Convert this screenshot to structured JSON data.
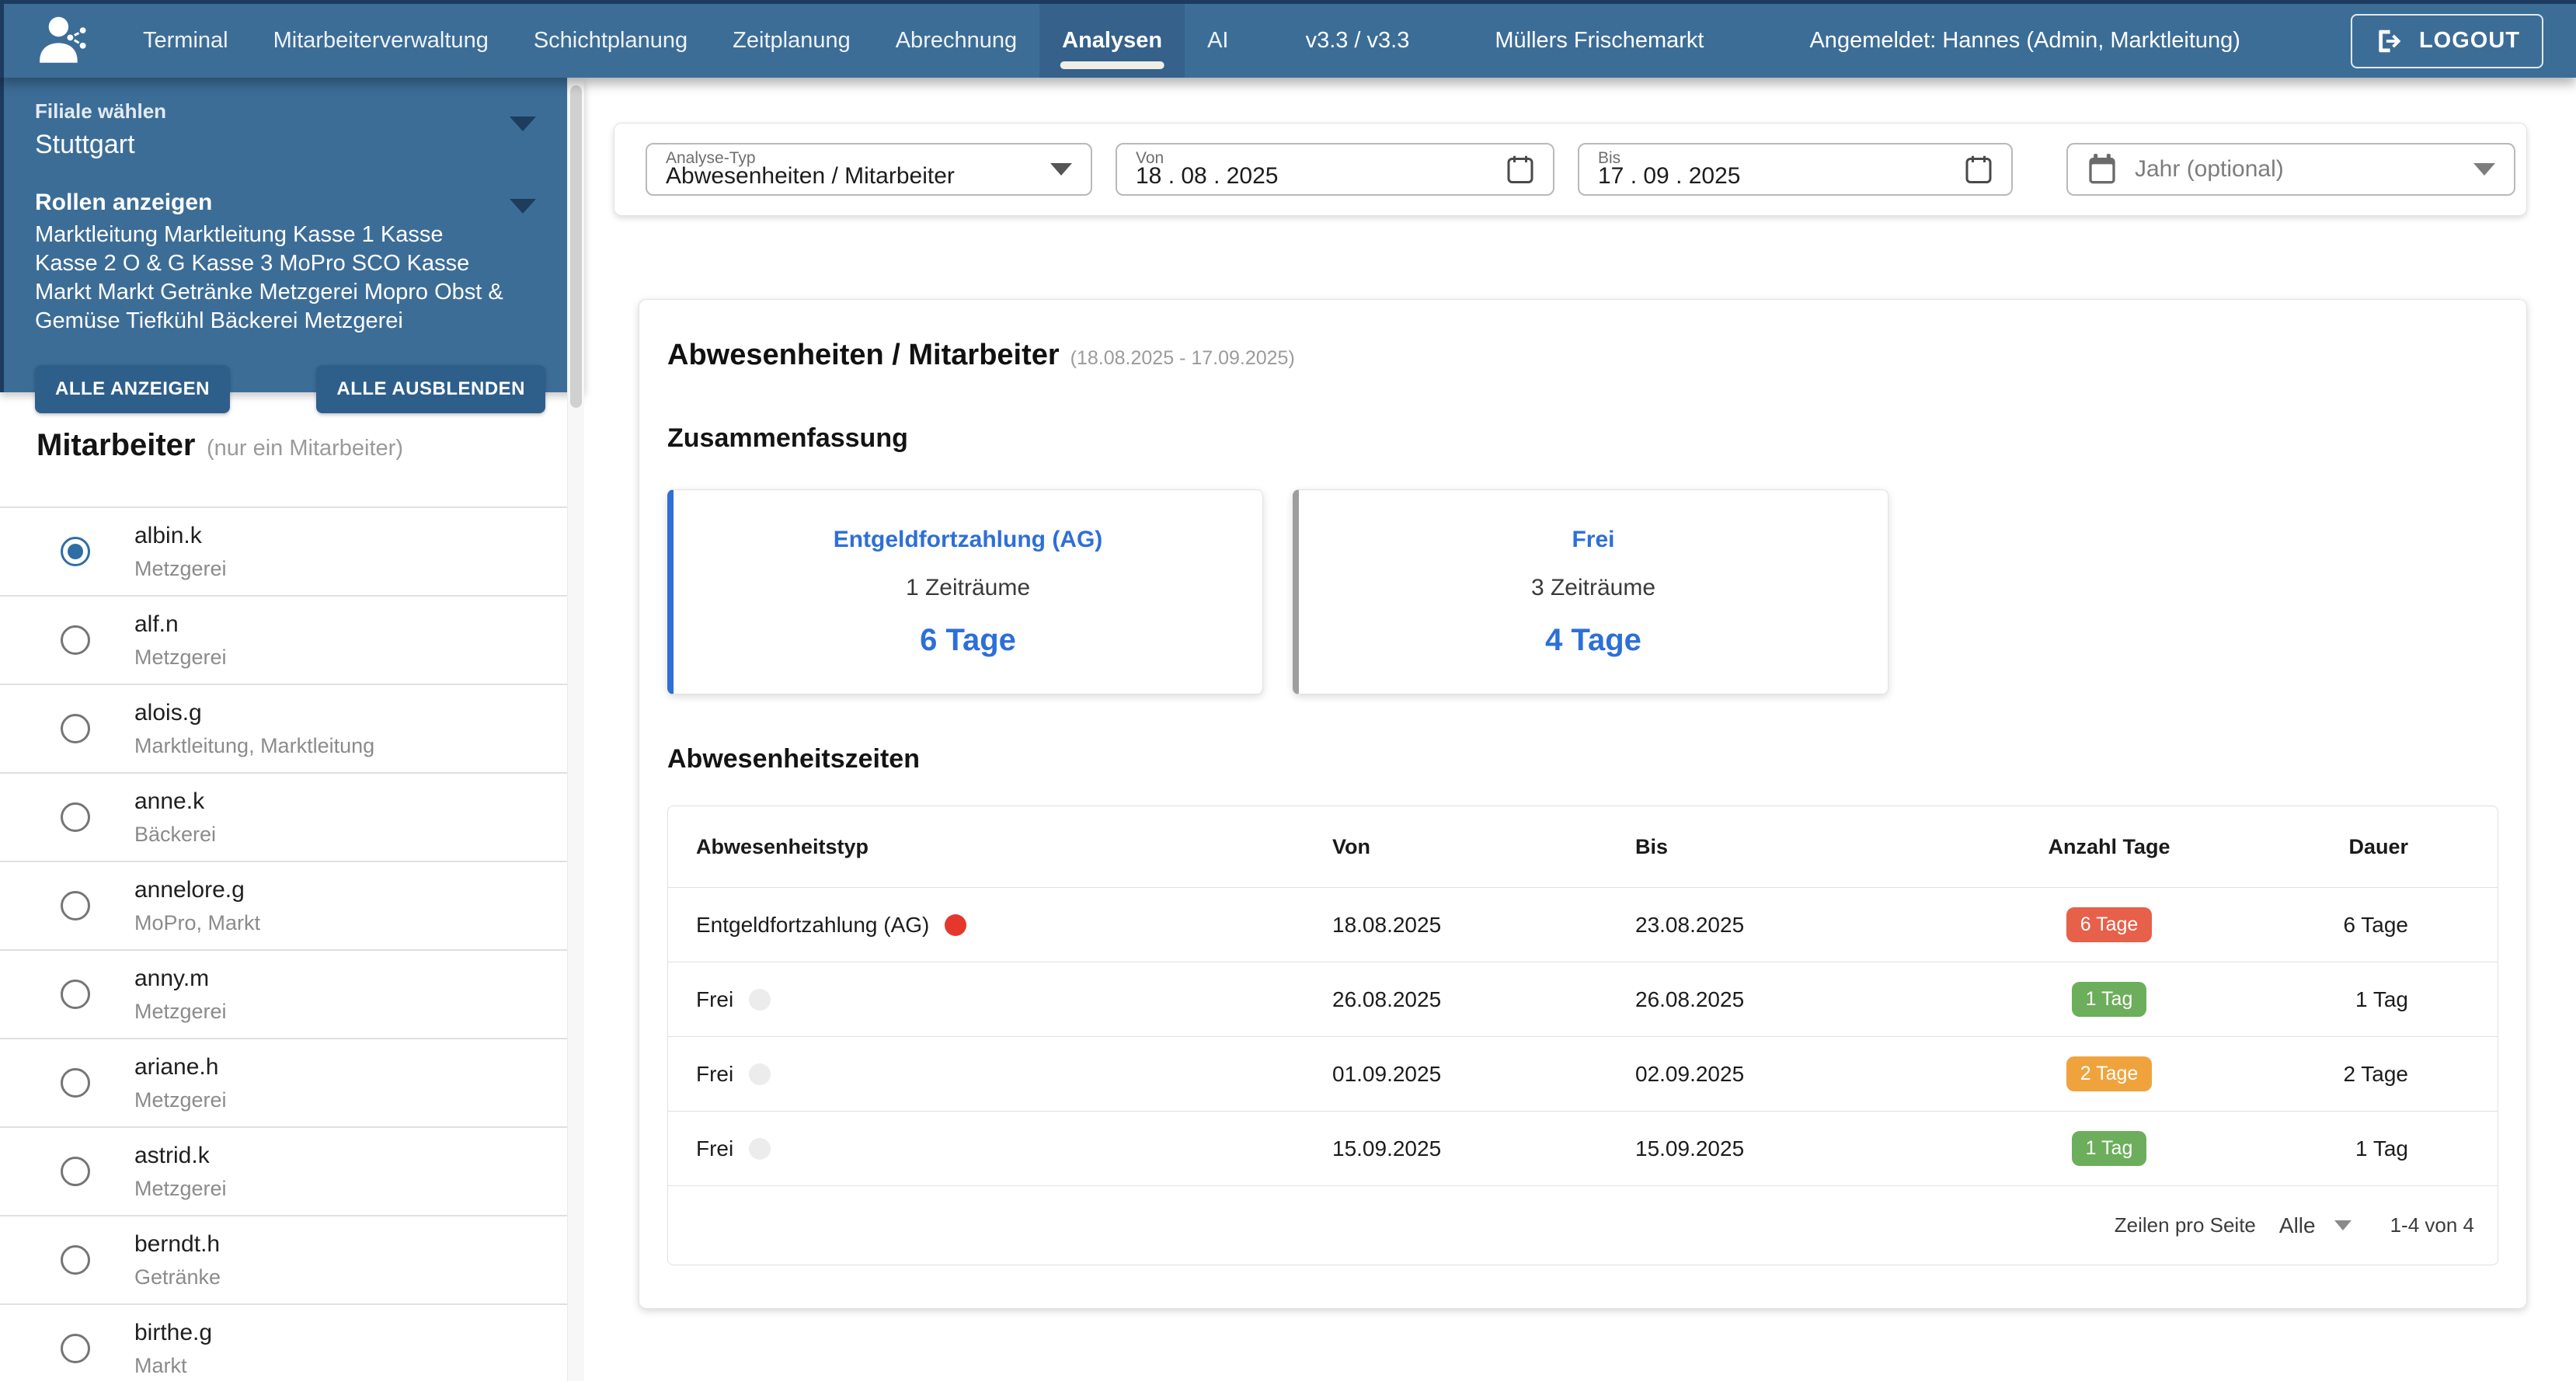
{
  "nav": {
    "items": [
      {
        "label": "Terminal",
        "active": false
      },
      {
        "label": "Mitarbeiterverwaltung",
        "active": false
      },
      {
        "label": "Schichtplanung",
        "active": false
      },
      {
        "label": "Zeitplanung",
        "active": false
      },
      {
        "label": "Abrechnung",
        "active": false
      },
      {
        "label": "Analysen",
        "active": true
      },
      {
        "label": "AI",
        "active": false
      }
    ],
    "version": "v3.3 / v3.3",
    "store": "Müllers Frischemarkt",
    "user": "Angemeldet: Hannes (Admin, Marktleitung)",
    "logout": "LOGOUT"
  },
  "sidebar": {
    "filiale_label": "Filiale wählen",
    "filiale_value": "Stuttgart",
    "rollen_label": "Rollen anzeigen",
    "rollen_value": "Marktleitung Marktleitung Kasse 1 Kasse Kasse 2 O & G Kasse 3 MoPro SCO Kasse Markt Markt Getränke Metzgerei Mopro Obst & Gemüse Tiefkühl Bäckerei Metzgerei",
    "show_all": "ALLE ANZEIGEN",
    "hide_all": "ALLE AUSBLENDEN",
    "mitarbeiter_title": "Mitarbeiter",
    "mitarbeiter_hint": "(nur ein Mitarbeiter)",
    "employees": [
      {
        "name": "albin.k",
        "role": "Metzgerei",
        "selected": true
      },
      {
        "name": "alf.n",
        "role": "Metzgerei",
        "selected": false
      },
      {
        "name": "alois.g",
        "role": "Marktleitung, Marktleitung",
        "selected": false
      },
      {
        "name": "anne.k",
        "role": "Bäckerei",
        "selected": false
      },
      {
        "name": "annelore.g",
        "role": "MoPro, Markt",
        "selected": false
      },
      {
        "name": "anny.m",
        "role": "Metzgerei",
        "selected": false
      },
      {
        "name": "ariane.h",
        "role": "Metzgerei",
        "selected": false
      },
      {
        "name": "astrid.k",
        "role": "Metzgerei",
        "selected": false
      },
      {
        "name": "berndt.h",
        "role": "Getränke",
        "selected": false
      },
      {
        "name": "birthe.g",
        "role": "Markt",
        "selected": false
      }
    ]
  },
  "filters": {
    "analyse_typ_label": "Analyse-Typ",
    "analyse_typ_value": "Abwesenheiten / Mitarbeiter",
    "von_label": "Von",
    "von_value": "18 . 08 . 2025",
    "bis_label": "Bis",
    "bis_value": "17 . 09 . 2025",
    "jahr_placeholder": "Jahr (optional)"
  },
  "report": {
    "title": "Abwesenheiten / Mitarbeiter",
    "range": "(18.08.2025 - 17.09.2025)",
    "summary_title": "Zusammenfassung",
    "summary_cards": [
      {
        "title": "Entgeldfortzahlung (AG)",
        "periods": "1 Zeiträume",
        "days": "6 Tage",
        "accent": "#2e6fd8"
      },
      {
        "title": "Frei",
        "periods": "3 Zeiträume",
        "days": "4 Tage",
        "accent": "#9e9e9e"
      }
    ],
    "table_title": "Abwesenheitszeiten",
    "table": {
      "columns": [
        "Abwesenheitstyp",
        "Von",
        "Bis",
        "Anzahl Tage",
        "Dauer"
      ],
      "rows": [
        {
          "type": "Entgeldfortzahlung (AG)",
          "dot": "#e5372c",
          "von": "18.08.2025",
          "bis": "23.08.2025",
          "badge": "6 Tage",
          "badge_color": "#e6604a",
          "dauer": "6 Tage"
        },
        {
          "type": "Frei",
          "dot": "#ececec",
          "von": "26.08.2025",
          "bis": "26.08.2025",
          "badge": "1 Tag",
          "badge_color": "#6cae5b",
          "dauer": "1 Tag"
        },
        {
          "type": "Frei",
          "dot": "#ececec",
          "von": "01.09.2025",
          "bis": "02.09.2025",
          "badge": "2 Tage",
          "badge_color": "#f0a33d",
          "dauer": "2 Tage"
        },
        {
          "type": "Frei",
          "dot": "#ececec",
          "von": "15.09.2025",
          "bis": "15.09.2025",
          "badge": "1 Tag",
          "badge_color": "#6cae5b",
          "dauer": "1 Tag"
        }
      ],
      "footer": {
        "rows_per_page_label": "Zeilen pro Seite",
        "rows_per_page_value": "Alle",
        "range_label": "1-4 von 4"
      }
    }
  },
  "theme": {
    "topbar_blue": "#3c6d97",
    "active_tab_blue": "#35618b",
    "accent_blue": "#2d6fd8",
    "radio_blue": "#2e6da6"
  }
}
